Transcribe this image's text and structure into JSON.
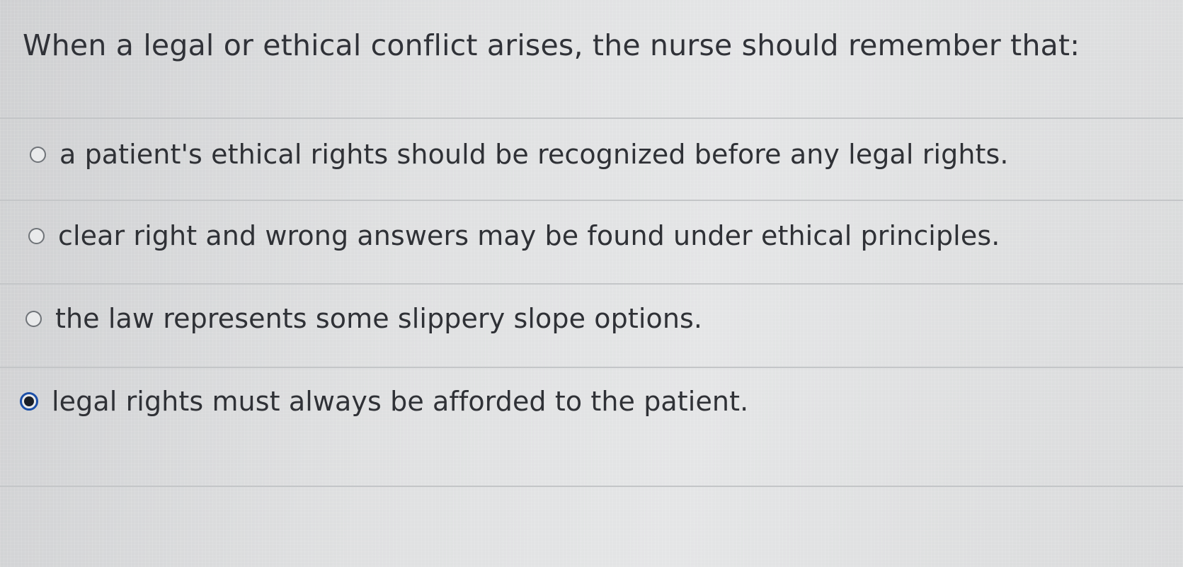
{
  "question": {
    "text": "When a legal or ethical conflict arises, the nurse should remember that:"
  },
  "options": [
    {
      "label": "a patient's ethical rights should be recognized before any legal rights.",
      "selected": false
    },
    {
      "label": "clear right and wrong answers may be found under ethical principles.",
      "selected": false
    },
    {
      "label": "the law represents some slippery slope options.",
      "selected": false
    },
    {
      "label": "legal rights must always be afforded to the patient.",
      "selected": true
    }
  ],
  "colors": {
    "selected_radio": "#1b4fa8",
    "text": "#2f3136"
  }
}
